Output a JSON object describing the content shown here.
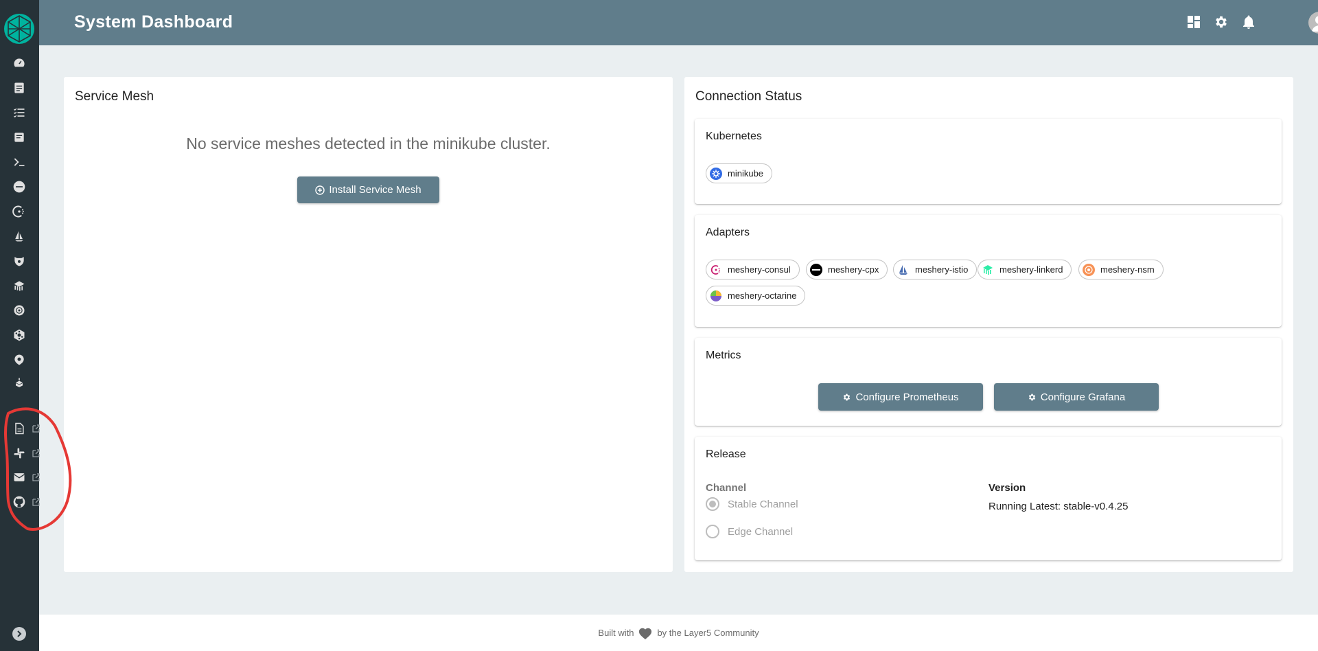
{
  "header": {
    "title": "System Dashboard",
    "icons": [
      "dashboard-icon",
      "gear-icon",
      "bell-icon",
      "account-icon"
    ]
  },
  "sidebar": {
    "icons": [
      "dashboard-icon",
      "performance-icon",
      "conformance-icon",
      "results-icon",
      "terminal-icon",
      "citrix-icon",
      "consul-icon",
      "istio-icon",
      "kuma-icon",
      "linkerd-icon",
      "nsm-icon",
      "octarine-icon",
      "traefik-icon",
      "cube-icon"
    ],
    "external_links": [
      "docs-icon",
      "slack-icon",
      "mail-icon",
      "github-icon"
    ]
  },
  "service_mesh": {
    "title": "Service Mesh",
    "empty_message": "No service meshes detected in the minikube cluster.",
    "install_button": "Install Service Mesh"
  },
  "connection_status": {
    "title": "Connection Status",
    "kubernetes": {
      "title": "Kubernetes",
      "chip": "minikube"
    },
    "adapters": {
      "title": "Adapters",
      "chips": [
        "meshery-consul",
        "meshery-cpx",
        "meshery-istio",
        "meshery-linkerd",
        "meshery-nsm",
        "meshery-octarine"
      ]
    },
    "metrics": {
      "title": "Metrics",
      "prometheus_button": "Configure Prometheus",
      "grafana_button": "Configure Grafana"
    },
    "release": {
      "title": "Release",
      "channel_label": "Channel",
      "stable_option": "Stable Channel",
      "edge_option": "Edge Channel",
      "version_label": "Version",
      "version_value": "Running Latest: stable-v0.4.25"
    }
  },
  "footer": {
    "prefix": "Built with",
    "suffix": "by the Layer5 Community"
  },
  "colors": {
    "sidebar": "#263238",
    "header": "#607d8b",
    "background": "#eaeff1",
    "accent": "#00b39f",
    "annotation": "#e53935"
  }
}
